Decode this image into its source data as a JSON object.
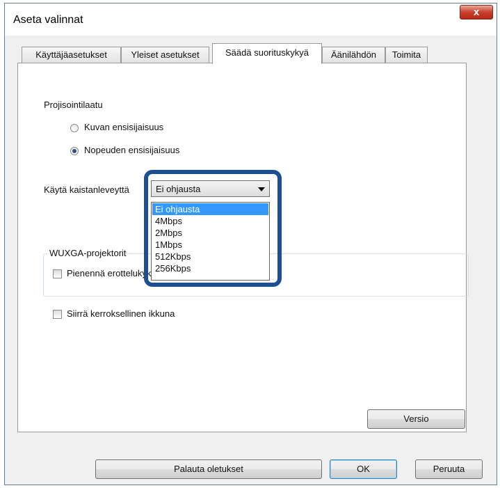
{
  "window": {
    "title": "Aseta valinnat",
    "close_glyph": "x"
  },
  "tabs": [
    {
      "label": "Käyttäjäasetukset",
      "active": false
    },
    {
      "label": "Yleiset asetukset",
      "active": false
    },
    {
      "label": "Säädä suorituskykyä",
      "active": true
    },
    {
      "label": "Äänilähdön",
      "active": false
    },
    {
      "label": "Toimita",
      "active": false
    }
  ],
  "projection": {
    "heading": "Projisointilaatu",
    "options": [
      {
        "label": "Kuvan ensisijaisuus",
        "selected": false
      },
      {
        "label": "Nopeuden ensisijaisuus",
        "selected": true
      }
    ]
  },
  "bandwidth": {
    "label": "Käytä kaistanleveyttä",
    "selected": "Ei ohjausta",
    "options": [
      "Ei ohjausta",
      "4Mbps",
      "2Mbps",
      "1Mbps",
      "512Kbps",
      "256Kbps"
    ]
  },
  "wuxga": {
    "legend": "WUXGA-projektorit",
    "checkbox_label": "Pienennä erottelukykyä",
    "checked": false
  },
  "layered_window": {
    "label": "Siirrä kerroksellinen ikkuna",
    "checked": false
  },
  "buttons": {
    "version": "Versio",
    "reset": "Palauta oletukset",
    "ok": "OK",
    "cancel": "Peruuta"
  },
  "colors": {
    "highlight_border": "#1b4f91",
    "selected_option_bg": "#3399ff",
    "close_button": "#c7402c"
  }
}
